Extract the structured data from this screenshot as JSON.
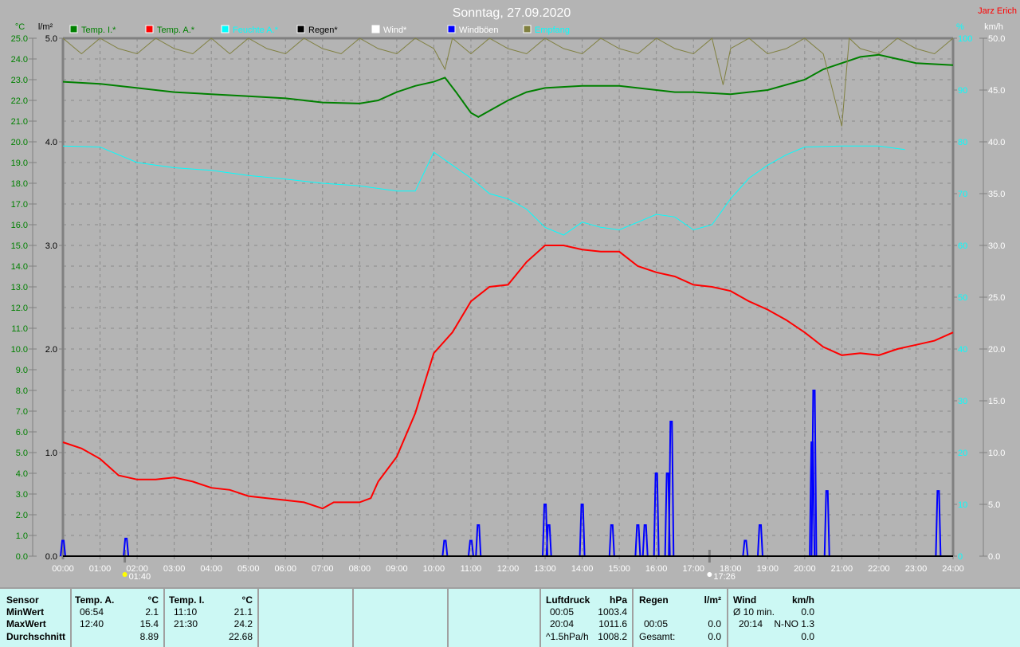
{
  "title": "Sonntag, 27.09.2020",
  "author": "Jarz Erich",
  "legend": [
    {
      "label": "Temp. I.*",
      "box": "#008000",
      "text": "#008000"
    },
    {
      "label": "Temp. A.*",
      "box": "#ff0000",
      "text": "#008000"
    },
    {
      "label": "Feuchte A.*",
      "box": "#00ffff",
      "text": "#00ffff"
    },
    {
      "label": "Regen*",
      "box": "#000000",
      "text": "#000000"
    },
    {
      "label": "Wind*",
      "box": "#ffffff",
      "text": "#ffffff"
    },
    {
      "label": "Windböen",
      "box": "#0000ff",
      "text": "#ffffff"
    },
    {
      "label": "Empfang",
      "box": "#808040",
      "text": "#00ffff"
    }
  ],
  "sun": {
    "rise": "01:40",
    "set": "17:26"
  },
  "chart_data": {
    "type": "line",
    "title": "Sonntag, 27.09.2020",
    "axes": {
      "temp": {
        "unit": "°C",
        "range": [
          0,
          25
        ],
        "ticks": [
          "0.0",
          "1.0",
          "2.0",
          "3.0",
          "4.0",
          "5.0",
          "6.0",
          "7.0",
          "8.0",
          "9.0",
          "10.0",
          "11.0",
          "12.0",
          "13.0",
          "14.0",
          "15.0",
          "16.0",
          "17.0",
          "18.0",
          "19.0",
          "20.0",
          "21.0",
          "22.0",
          "23.0",
          "24.0",
          "25.0"
        ]
      },
      "rain": {
        "unit": "l/m²",
        "range": [
          0,
          5
        ],
        "ticks": [
          "0.0",
          "1.0",
          "2.0",
          "3.0",
          "4.0",
          "5.0"
        ]
      },
      "humidity": {
        "unit": "%",
        "range": [
          0,
          100
        ],
        "ticks": [
          "0",
          "10",
          "20",
          "30",
          "40",
          "50",
          "60",
          "70",
          "80",
          "90",
          "100"
        ]
      },
      "wind": {
        "unit": "km/h",
        "range": [
          0,
          50
        ],
        "ticks": [
          "0.0",
          "5.0",
          "10.0",
          "15.0",
          "20.0",
          "25.0",
          "30.0",
          "35.0",
          "40.0",
          "45.0",
          "50.0"
        ]
      },
      "x": {
        "range": [
          0,
          24
        ],
        "ticks": [
          "00:00",
          "01:00",
          "02:00",
          "03:00",
          "04:00",
          "05:00",
          "06:00",
          "07:00",
          "08:00",
          "09:00",
          "10:00",
          "11:00",
          "12:00",
          "13:00",
          "14:00",
          "15:00",
          "16:00",
          "17:00",
          "18:00",
          "19:00",
          "20:00",
          "21:00",
          "22:00",
          "23:00",
          "24:00"
        ]
      }
    },
    "series": [
      {
        "name": "Temp. I.*",
        "axis": "temp",
        "color": "#008000",
        "x": [
          0,
          1,
          2,
          3,
          4,
          5,
          6,
          7,
          8,
          8.5,
          9,
          9.5,
          10,
          10.3,
          10.6,
          11,
          11.2,
          11.5,
          12,
          12.5,
          13,
          14,
          15,
          16,
          16.5,
          17,
          18,
          19,
          20,
          20.5,
          21,
          21.5,
          22,
          22.5,
          23,
          24
        ],
        "y": [
          22.9,
          22.8,
          22.6,
          22.4,
          22.3,
          22.2,
          22.1,
          21.9,
          21.85,
          22.0,
          22.4,
          22.7,
          22.9,
          23.1,
          22.4,
          21.4,
          21.2,
          21.5,
          22.0,
          22.4,
          22.6,
          22.7,
          22.7,
          22.5,
          22.4,
          22.4,
          22.3,
          22.5,
          23.0,
          23.5,
          23.8,
          24.1,
          24.2,
          24.0,
          23.8,
          23.7
        ]
      },
      {
        "name": "Temp. A.*",
        "axis": "temp",
        "color": "#ff0000",
        "x": [
          0,
          0.5,
          1,
          1.5,
          2,
          2.5,
          3,
          3.5,
          4,
          4.5,
          5,
          5.5,
          6,
          6.5,
          7,
          7.3,
          8,
          8.3,
          8.5,
          9,
          9.5,
          10,
          10.5,
          11,
          11.5,
          12,
          12.5,
          13,
          13.5,
          14,
          14.5,
          15,
          15.5,
          16,
          16.5,
          17,
          17.5,
          18,
          18.5,
          19,
          19.5,
          20,
          20.5,
          21,
          21.5,
          22,
          22.5,
          23,
          23.5,
          24
        ],
        "y": [
          5.5,
          5.2,
          4.7,
          3.9,
          3.7,
          3.7,
          3.8,
          3.6,
          3.3,
          3.2,
          2.9,
          2.8,
          2.7,
          2.6,
          2.3,
          2.6,
          2.6,
          2.8,
          3.6,
          4.8,
          6.9,
          9.8,
          10.8,
          12.3,
          13.0,
          13.1,
          14.2,
          15.0,
          15.0,
          14.8,
          14.7,
          14.7,
          14.0,
          13.7,
          13.5,
          13.1,
          13.0,
          12.8,
          12.3,
          11.9,
          11.4,
          10.8,
          10.1,
          9.7,
          9.8,
          9.7,
          10.0,
          10.2,
          10.4,
          10.8
        ]
      },
      {
        "name": "Feuchte A.*",
        "axis": "humidity",
        "color": "#00ffff",
        "x": [
          0,
          1,
          2,
          3,
          4,
          5,
          6,
          7,
          8,
          9,
          9.5,
          10,
          10.5,
          11,
          11.5,
          12,
          12.5,
          13,
          13.5,
          14,
          14.5,
          15,
          15.5,
          16,
          16.5,
          17,
          17.5,
          18,
          18.5,
          19,
          19.5,
          20,
          21,
          22,
          22.7
        ],
        "y": [
          79.2,
          79,
          76,
          75,
          74.5,
          73.5,
          72.8,
          72,
          71.5,
          70.5,
          70.5,
          78,
          75.5,
          73,
          70,
          69,
          67,
          63.5,
          62,
          64.5,
          63.5,
          63,
          64.5,
          66,
          65.5,
          63,
          64,
          69,
          73,
          75.5,
          77.5,
          79,
          79.2,
          79.2,
          78.5
        ]
      },
      {
        "name": "Windböen",
        "axis": "wind",
        "color": "#0000ff",
        "type": "spikes",
        "x": [
          0,
          1.7,
          10.3,
          11.0,
          11.2,
          13.0,
          13.1,
          14.0,
          14.8,
          15.5,
          15.7,
          16.0,
          16.3,
          16.4,
          18.4,
          18.8,
          20.2,
          20.25,
          20.6,
          23.6
        ],
        "y": [
          1.5,
          1.7,
          1.5,
          1.5,
          3.0,
          5.0,
          3.0,
          5.0,
          3.0,
          3.0,
          3.0,
          8.0,
          8.0,
          13.0,
          1.5,
          3.0,
          11.0,
          16.0,
          6.3,
          6.3
        ]
      },
      {
        "name": "Regen*",
        "axis": "rain",
        "color": "#000000",
        "x": [
          0,
          24
        ],
        "y": [
          0,
          0
        ]
      },
      {
        "name": "Empfang",
        "axis": "humidity",
        "color": "#808040",
        "x": [
          0,
          0.5,
          1,
          1.5,
          2,
          2.5,
          3,
          3.5,
          4,
          4.5,
          5,
          5.5,
          6,
          6.5,
          7,
          7.5,
          8,
          8.5,
          9,
          9.5,
          10,
          10.3,
          10.5,
          11,
          11.5,
          12,
          12.5,
          13,
          13.5,
          14,
          14.5,
          15,
          15.5,
          16,
          16.5,
          17,
          17.5,
          17.8,
          18,
          18.5,
          19,
          19.5,
          20,
          20.5,
          21,
          21.2,
          21.5,
          22,
          22.5,
          23,
          23.5,
          24
        ],
        "y": [
          100,
          97,
          100,
          98,
          97,
          100,
          98,
          97,
          100,
          97,
          100,
          98,
          97,
          100,
          98,
          97,
          100,
          98,
          97,
          100,
          98,
          94,
          100,
          97,
          100,
          98,
          97,
          100,
          98,
          97,
          100,
          98,
          97,
          100,
          98,
          97,
          100,
          91,
          98,
          100,
          97,
          98,
          100,
          97,
          83,
          100,
          98,
          97,
          100,
          98,
          97,
          100
        ]
      }
    ]
  },
  "table": {
    "sensor": {
      "h": "Sensor",
      "min": "MinWert",
      "max": "MaxWert",
      "avg": "Durchschnitt"
    },
    "tempA": {
      "h": "Temp. A.",
      "u": "°C",
      "min_t": "06:54",
      "min": "2.1",
      "max_t": "12:40",
      "max": "15.4",
      "avg": "8.89"
    },
    "tempI": {
      "h": "Temp. I.",
      "u": "°C",
      "min_t": "11:10",
      "min": "21.1",
      "max_t": "21:30",
      "max": "24.2",
      "avg": "22.68"
    },
    "press": {
      "h": "Luftdruck",
      "u": "hPa",
      "min_t": "00:05",
      "min": "1003.4",
      "max_t": "20:04",
      "max": "1011.6",
      "trend": "^1.5hPa/h",
      "avg": "1008.2"
    },
    "rain": {
      "h": "Regen",
      "u": "l/m²",
      "max_t": "00:05",
      "max": "0.0",
      "tot_l": "Gesamt:",
      "tot": "0.0"
    },
    "wind": {
      "h": "Wind",
      "u": "km/h",
      "avg_l": "Ø 10 min.",
      "avg": "0.0",
      "max_t": "20:14",
      "max": "N-NO 1.3",
      "last": "0.0"
    }
  }
}
